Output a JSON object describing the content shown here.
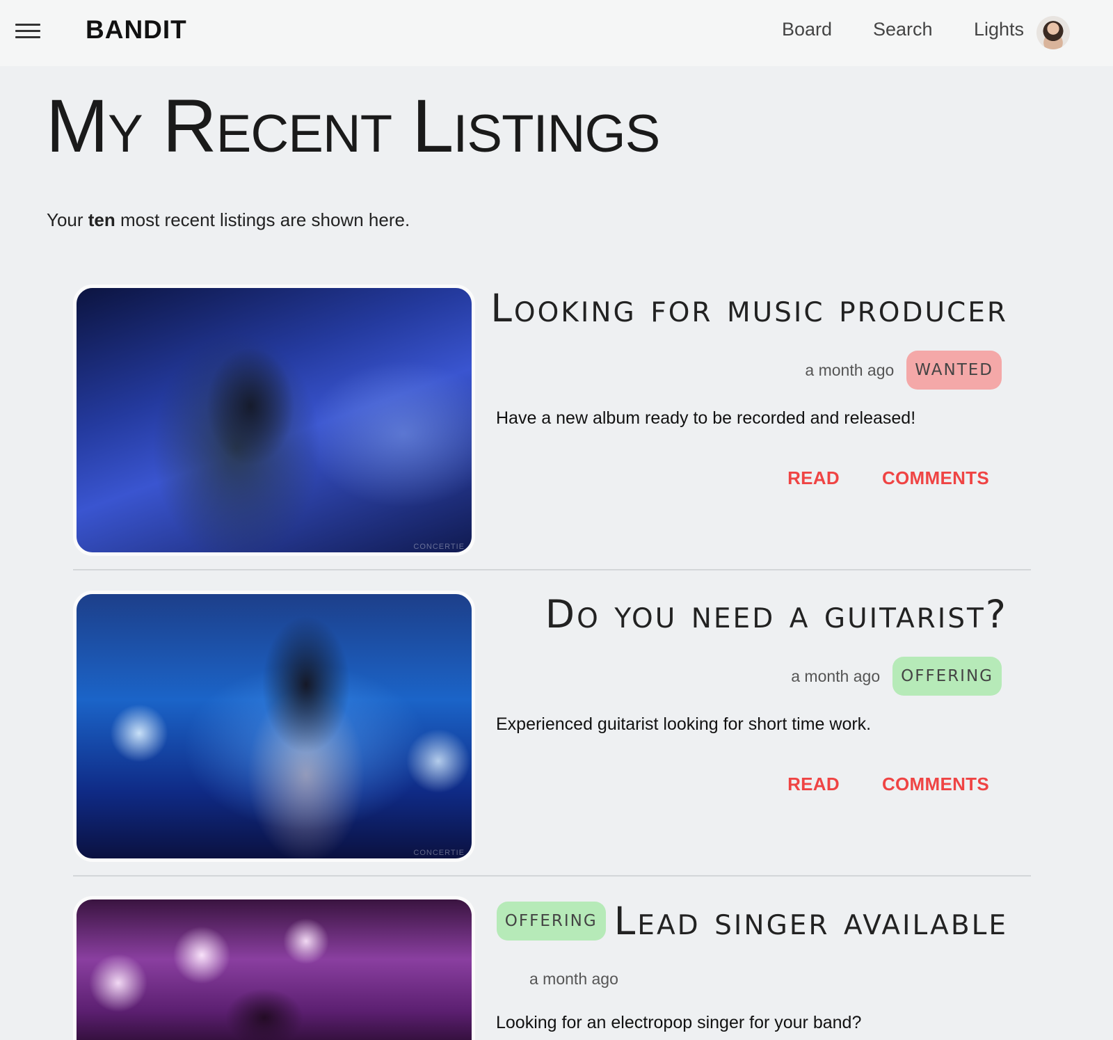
{
  "header": {
    "brand": "BANDIT",
    "nav": [
      "Board",
      "Search",
      "Lights"
    ]
  },
  "page": {
    "title": "My Recent Listings",
    "intro_pre": "Your ",
    "intro_bold": "ten",
    "intro_post": " most recent listings are shown here."
  },
  "listings": [
    {
      "title": "Looking for music producer",
      "time": "a month ago",
      "badge": "WANTED",
      "description": "Have a new album ready to be recorded and released!",
      "read_label": "READ",
      "comments_label": "COMMENTS",
      "watermark": "CONCERTIE"
    },
    {
      "title": "Do you need a guitarist?",
      "time": "a month ago",
      "badge": "OFFERING",
      "description": "Experienced guitarist looking for short time work.",
      "read_label": "READ",
      "comments_label": "COMMENTS",
      "watermark": "CONCERTIE"
    },
    {
      "title": "Lead singer available",
      "time": "a month ago",
      "badge": "OFFERING",
      "description": "Looking for an electropop singer for your band?"
    }
  ],
  "colors": {
    "accent": "#ef4444",
    "wanted": "#f4a8a8",
    "offering": "#b6eab8",
    "background": "#eef0f2"
  },
  "icons": {
    "menu": "hamburger-menu-icon",
    "avatar": "user-avatar"
  }
}
